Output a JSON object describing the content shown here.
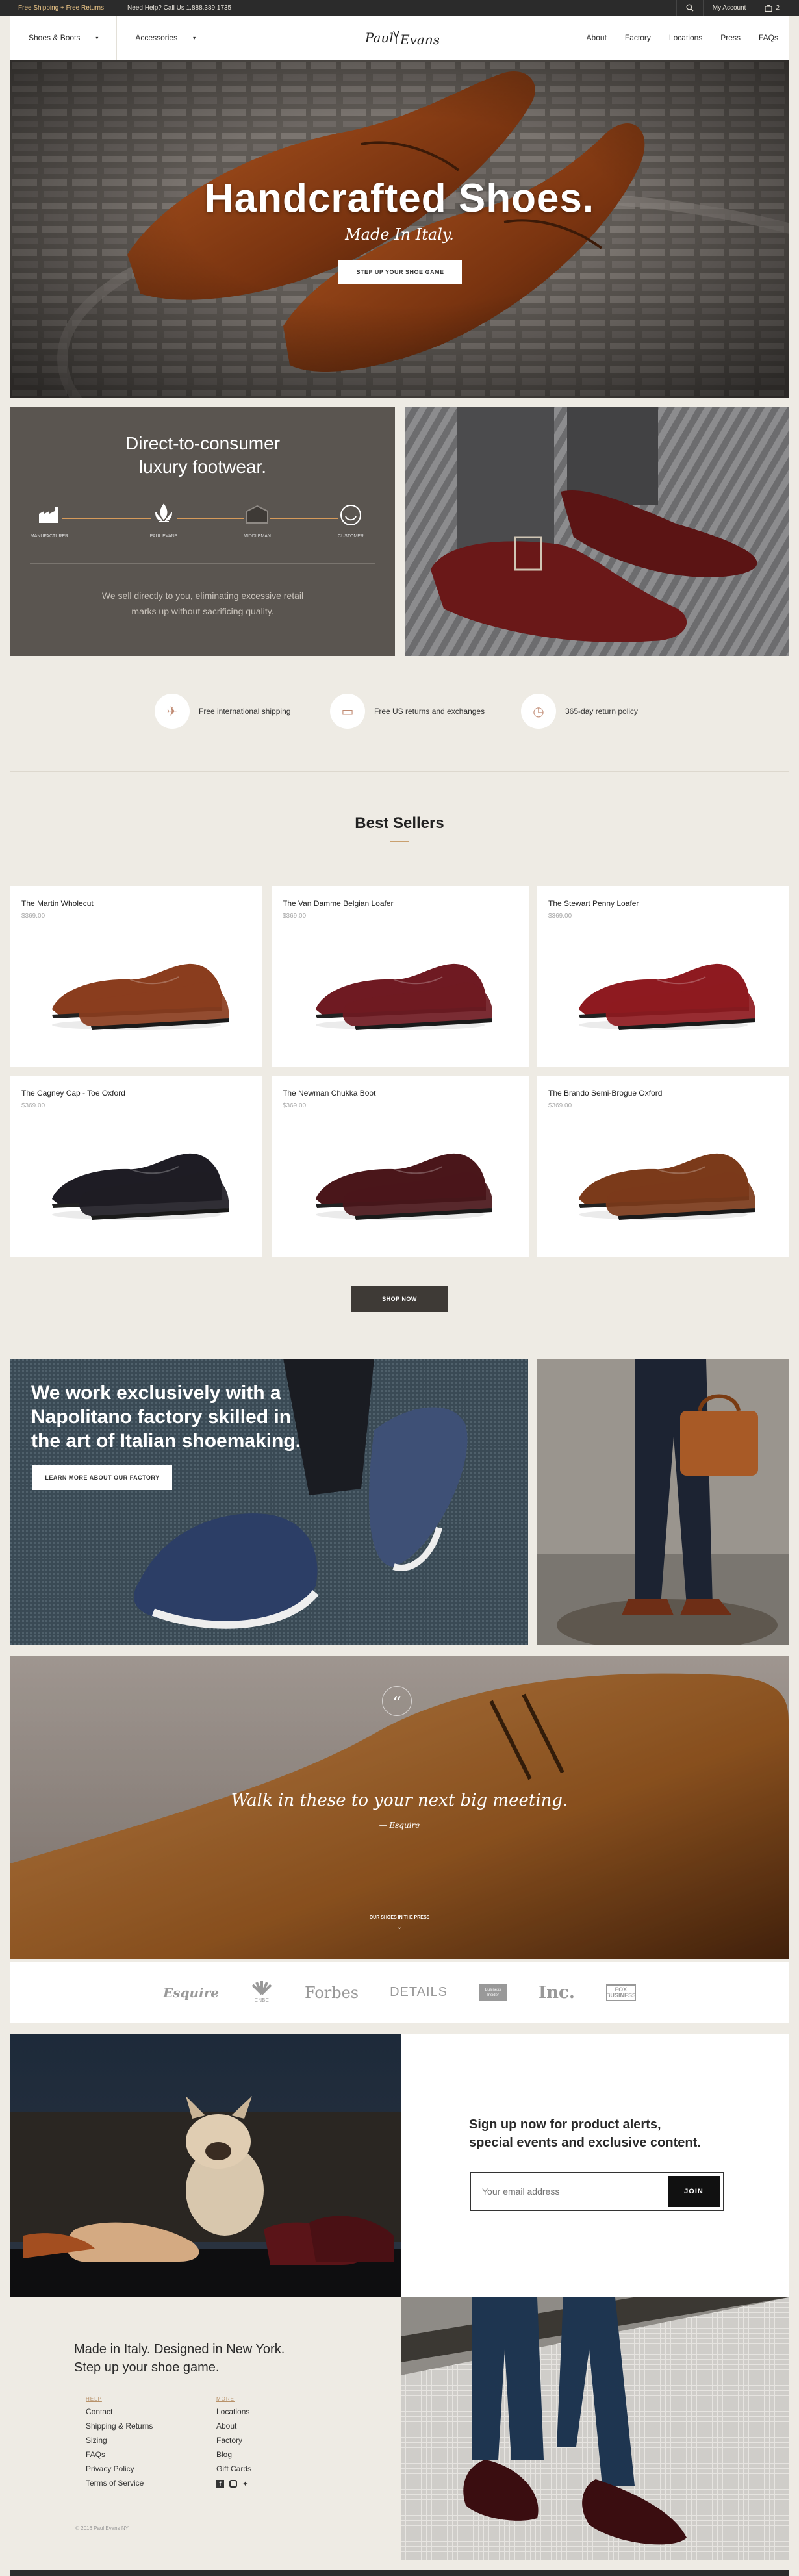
{
  "topbar": {
    "shipping": "Free Shipping + Free Returns",
    "help": "Need Help? Call Us 1.888.389.1735",
    "account": "My Account",
    "cart_count": "2"
  },
  "nav": {
    "shoes": "Shoes & Boots",
    "accessories": "Accessories",
    "logo": "Paul Evans",
    "links": [
      "About",
      "Factory",
      "Locations",
      "Press",
      "FAQs"
    ]
  },
  "hero": {
    "title": "Handcrafted Shoes.",
    "subtitle": "Made In Italy.",
    "cta": "STEP UP YOUR SHOE GAME"
  },
  "dtc": {
    "title_line1": "Direct-to-consumer",
    "title_line2": "luxury footwear.",
    "steps": [
      "MANUFACTURER",
      "PAUL EVANS",
      "MIDDLEMAN",
      "CUSTOMER"
    ],
    "body_line1": "We sell directly to you, eliminating excessive retail",
    "body_line2": "marks up without sacrificing quality."
  },
  "features": [
    "Free international shipping",
    "Free US returns and exchanges",
    "365-day return policy"
  ],
  "best_sellers": {
    "title": "Best Sellers",
    "products": [
      {
        "name": "The Martin Wholecut",
        "price": "$369.00",
        "color": "#8a3d1e"
      },
      {
        "name": "The Van Damme Belgian Loafer",
        "price": "$369.00",
        "color": "#6f1a22"
      },
      {
        "name": "The Stewart Penny Loafer",
        "price": "$369.00",
        "color": "#8e1a20"
      },
      {
        "name": "The Cagney Cap - Toe Oxford",
        "price": "$369.00",
        "color": "#1e1c24"
      },
      {
        "name": "The Newman Chukka Boot",
        "price": "$369.00",
        "color": "#4a161a"
      },
      {
        "name": "The Brando Semi-Brogue Oxford",
        "price": "$369.00",
        "color": "#7b3a1a"
      }
    ],
    "cta": "SHOP NOW"
  },
  "factory": {
    "line1": "We work exclusively with a",
    "line2": "Napolitano factory skilled in",
    "line3": "the art of Italian shoemaking.",
    "cta": "LEARN MORE ABOUT OUR FACTORY"
  },
  "quote": {
    "mark": "“",
    "text": "Walk in these to your next big meeting.",
    "source": "— Esquire",
    "press_label": "OUR SHOES IN THE PRESS"
  },
  "press": [
    "Esquire",
    "CNBC",
    "Forbes",
    "DETAILS",
    "Business Insider",
    "Inc.",
    "FOX BUSINESS"
  ],
  "signup": {
    "line1": "Sign up now for product alerts,",
    "line2": "special events and exclusive content.",
    "placeholder": "Your email address",
    "button": "JOIN"
  },
  "footer": {
    "title_line1": "Made in Italy. Designed in New York.",
    "title_line2": "Step up your shoe game.",
    "help_heading": "HELP",
    "help_links": [
      "Contact",
      "Shipping & Returns",
      "Sizing",
      "FAQs",
      "Privacy Policy",
      "Terms of Service"
    ],
    "more_heading": "MORE",
    "more_links": [
      "Locations",
      "About",
      "Factory",
      "Blog",
      "Gift Cards"
    ],
    "copyright": "© 2016 Paul Evans NY"
  }
}
